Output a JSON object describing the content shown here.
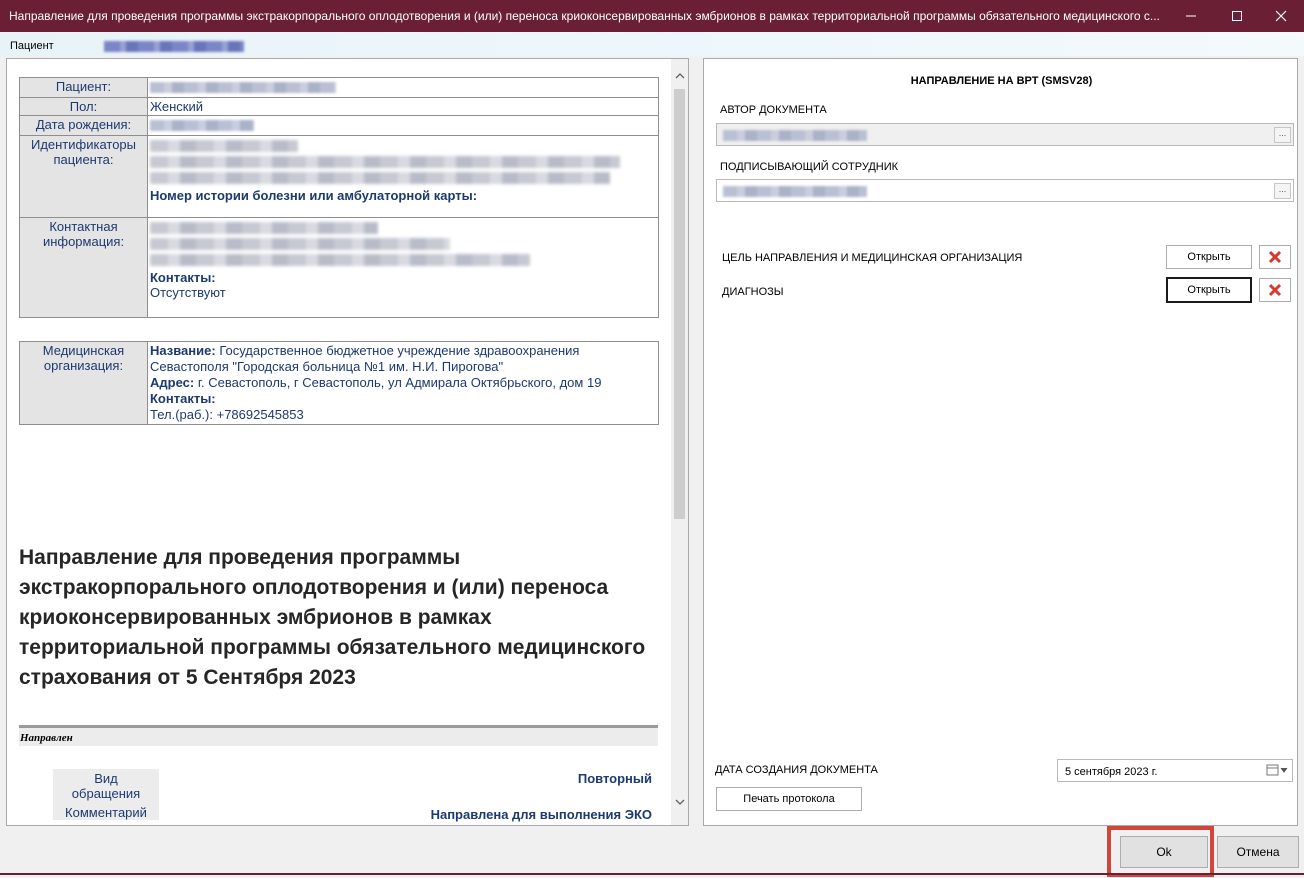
{
  "window": {
    "title": "Направление для проведения программы экстракорпорального оплодотворения и (или) переноса криоконсервированных эмбрионов в рамках территориальной программы обязательного медицинского с...",
    "min_icon": "minimize-icon",
    "max_icon": "maximize-icon",
    "close_icon": "close-icon"
  },
  "patient_strip": {
    "label": "Пациент"
  },
  "doc": {
    "patient_label": "Пациент:",
    "sex_label": "Пол:",
    "sex_value": "Женский",
    "dob_label": "Дата рождения:",
    "ids_label": "Идентификаторы пациента:",
    "history_label": "Номер истории болезни или амбулаторной карты:",
    "contact_label": "Контактная информация:",
    "contacts_label": "Контакты:",
    "contacts_value": "Отсутствуют",
    "org_label": "Медицинская организация:",
    "org_name_label": "Название:",
    "org_name_value": "Государственное бюджетное учреждение здравоохранения Севастополя \"Городская больница №1 им. Н.И. Пирогова\"",
    "org_address_label": "Адрес:",
    "org_address_value": "г. Севастополь, г Севастополь, ул Адмирала Октябрьского, дом 19",
    "org_contacts_label": "Контакты:",
    "org_contacts_value": "Тел.(раб.): +78692545853",
    "title": "Направление для проведения программы экстракорпорального оплодотворения и (или) переноса криоконсервированных эмбрионов в рамках территориальной программы обязательного медицинского страхования от 5 Сентября 2023",
    "section_label": "Направлен",
    "visit_type_label": "Вид обращения",
    "visit_type_value": "Повторный",
    "comment_label": "Комментарий",
    "comment_value": "Направлена для выполнения ЭКО"
  },
  "form": {
    "header": "НАПРАВЛЕНИЕ НА ВРТ (SMSV28)",
    "author_label": "АВТОР ДОКУМЕНТА",
    "signer_label": "ПОДПИСЫВАЮЩИЙ СОТРУДНИК",
    "ellipsis": "...",
    "purpose_label": "ЦЕЛЬ НАПРАВЛЕНИЯ И МЕДИЦИНСКАЯ ОРГАНИЗАЦИЯ",
    "diagnoses_label": "ДИАГНОЗЫ",
    "open_label": "Открыть",
    "date_label": "ДАТА СОЗДАНИЯ ДОКУМЕНТА",
    "date_value": "5 сентября 2023 г.",
    "print_label": "Печать протокола"
  },
  "footer": {
    "ok_label": "Ok",
    "cancel_label": "Отмена"
  },
  "colors": {
    "titlebar": "#6b1f35",
    "label_text": "#1c3a70",
    "highlight_box": "#d0453c",
    "delete_icon": "#d43a2f"
  }
}
